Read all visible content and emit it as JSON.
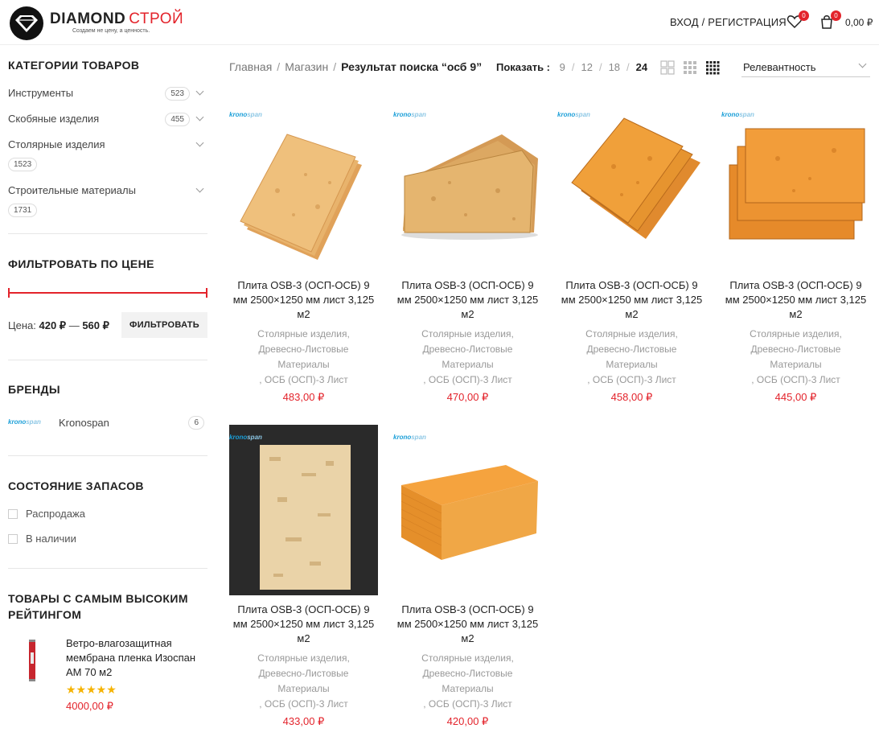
{
  "header": {
    "logo_main": "DIAMOND",
    "logo_accent": "СТРОЙ",
    "logo_tagline": "Создаем не цену, а ценность.",
    "login_label": "ВХОД / РЕГИСТРАЦИЯ",
    "wishlist_count": "0",
    "cart_count": "0",
    "cart_total": "0,00 ₽",
    "accent_color": "#e3232b"
  },
  "sidebar": {
    "categories_title": "КАТЕГОРИИ ТОВАРОВ",
    "categories": [
      {
        "label": "Инструменты",
        "count": "523"
      },
      {
        "label": "Скобяные изделия",
        "count": "455"
      },
      {
        "label": "Столярные изделия",
        "count": "1523"
      },
      {
        "label": "Строительные материалы",
        "count": "1731"
      }
    ],
    "price_title": "ФИЛЬТРОВАТЬ ПО ЦЕНЕ",
    "price_prefix": "Цена:",
    "price_min": "420 ₽",
    "price_max": "560 ₽",
    "price_dash": "—",
    "filter_button": "ФИЛЬТРОВАТЬ",
    "brands_title": "БРЕНДЫ",
    "brand": {
      "logo_a": "krono",
      "logo_b": "span",
      "name": "Kronospan",
      "count": "6"
    },
    "stock_title": "СОСТОЯНИЕ ЗАПАСОВ",
    "stock_options": [
      "Распродажа",
      "В наличии"
    ],
    "top_rated_title": "ТОВАРЫ С САМЫМ ВЫСОКИМ РЕЙТИНГОМ",
    "top_rated": {
      "title": "Ветро-влагозащитная мембрана пленка Изоспан АМ 70 м2",
      "rating": 5,
      "stars": "★★★★★",
      "price": "4000,00 ₽"
    }
  },
  "toolbar": {
    "breadcrumb": [
      "Главная",
      "Магазин",
      "Результат поиска “осб 9”"
    ],
    "breadcrumb_sep": "/",
    "show_label": "Показать :",
    "per_page": [
      "9",
      "12",
      "18",
      "24"
    ],
    "per_page_active": "24",
    "sort_value": "Релевантность"
  },
  "products": [
    {
      "brand_a": "krono",
      "brand_b": "span",
      "title": "Плита OSB-3 (ОСП-ОСБ) 9 мм 2500×1250 мм лист 3,125 м2",
      "cats": [
        "Столярные изделия,",
        "Древесно-Листовые",
        "Материалы",
        ", ОСБ (ОСП)-3 Лист"
      ],
      "price": "483,00 ₽"
    },
    {
      "brand_a": "krono",
      "brand_b": "span",
      "title": "Плита OSB-3 (ОСП-ОСБ) 9 мм 2500×1250 мм лист 3,125 м2",
      "cats": [
        "Столярные изделия,",
        "Древесно-Листовые",
        "Материалы",
        ", ОСБ (ОСП)-3 Лист"
      ],
      "price": "470,00 ₽"
    },
    {
      "brand_a": "krono",
      "brand_b": "span",
      "title": "Плита OSB-3 (ОСП-ОСБ) 9 мм 2500×1250 мм лист 3,125 м2",
      "cats": [
        "Столярные изделия,",
        "Древесно-Листовые",
        "Материалы",
        ", ОСБ (ОСП)-3 Лист"
      ],
      "price": "458,00 ₽"
    },
    {
      "brand_a": "krono",
      "brand_b": "span",
      "title": "Плита OSB-3 (ОСП-ОСБ) 9 мм 2500×1250 мм лист 3,125 м2",
      "cats": [
        "Столярные изделия,",
        "Древесно-Листовые",
        "Материалы",
        ", ОСБ (ОСП)-3 Лист"
      ],
      "price": "445,00 ₽"
    },
    {
      "brand_a": "krono",
      "brand_b": "span",
      "title": "Плита OSB-3 (ОСП-ОСБ) 9 мм 2500×1250 мм лист 3,125 м2",
      "cats": [
        "Столярные изделия,",
        "Древесно-Листовые",
        "Материалы",
        ", ОСБ (ОСП)-3 Лист"
      ],
      "price": "433,00 ₽"
    },
    {
      "brand_a": "krono",
      "brand_b": "span",
      "title": "Плита OSB-3 (ОСП-ОСБ) 9 мм 2500×1250 мм лист 3,125 м2",
      "cats": [
        "Столярные изделия,",
        "Древесно-Листовые",
        "Материалы",
        ", ОСБ (ОСП)-3 Лист"
      ],
      "price": "420,00 ₽"
    }
  ]
}
